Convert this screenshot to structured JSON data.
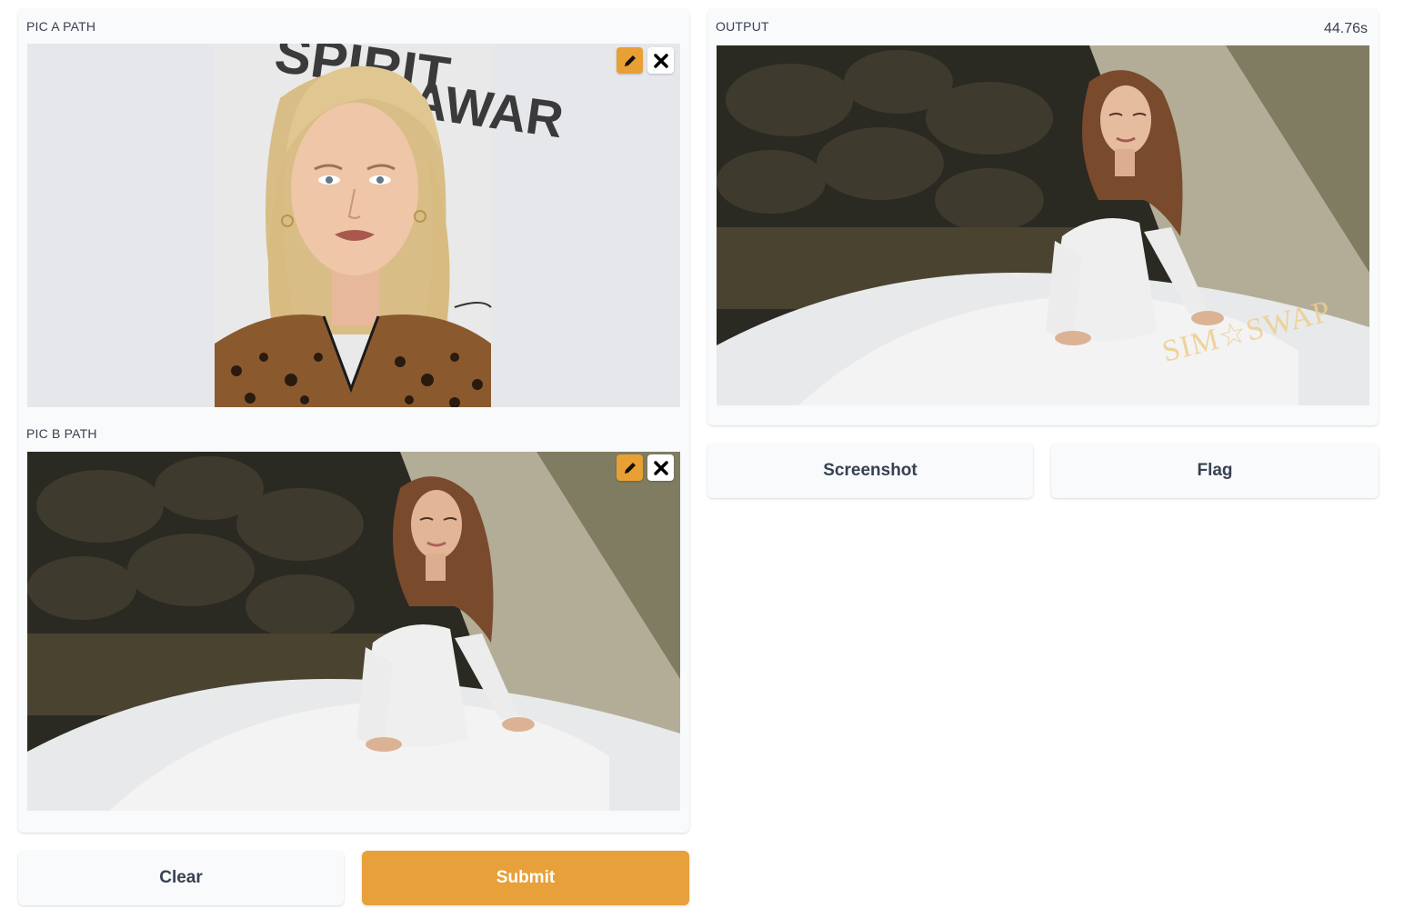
{
  "inputs": {
    "pic_a": {
      "label": "PIC A PATH",
      "image": "portrait-blonde-woman"
    },
    "pic_b": {
      "label": "PIC B PATH",
      "image": "bride-white-gown-rocks"
    }
  },
  "output": {
    "label": "OUTPUT",
    "elapsed": "44.76s",
    "image": "face-swapped-bride",
    "watermark": "SIM☆SWAP"
  },
  "actions": {
    "clear_label": "Clear",
    "submit_label": "Submit",
    "screenshot_label": "Screenshot",
    "flag_label": "Flag"
  },
  "icons": {
    "edit": "pencil-icon",
    "remove": "close-x-icon"
  },
  "colors": {
    "accent": "#e8a03a",
    "panel_bg": "#f9fafb",
    "text": "#374151"
  }
}
